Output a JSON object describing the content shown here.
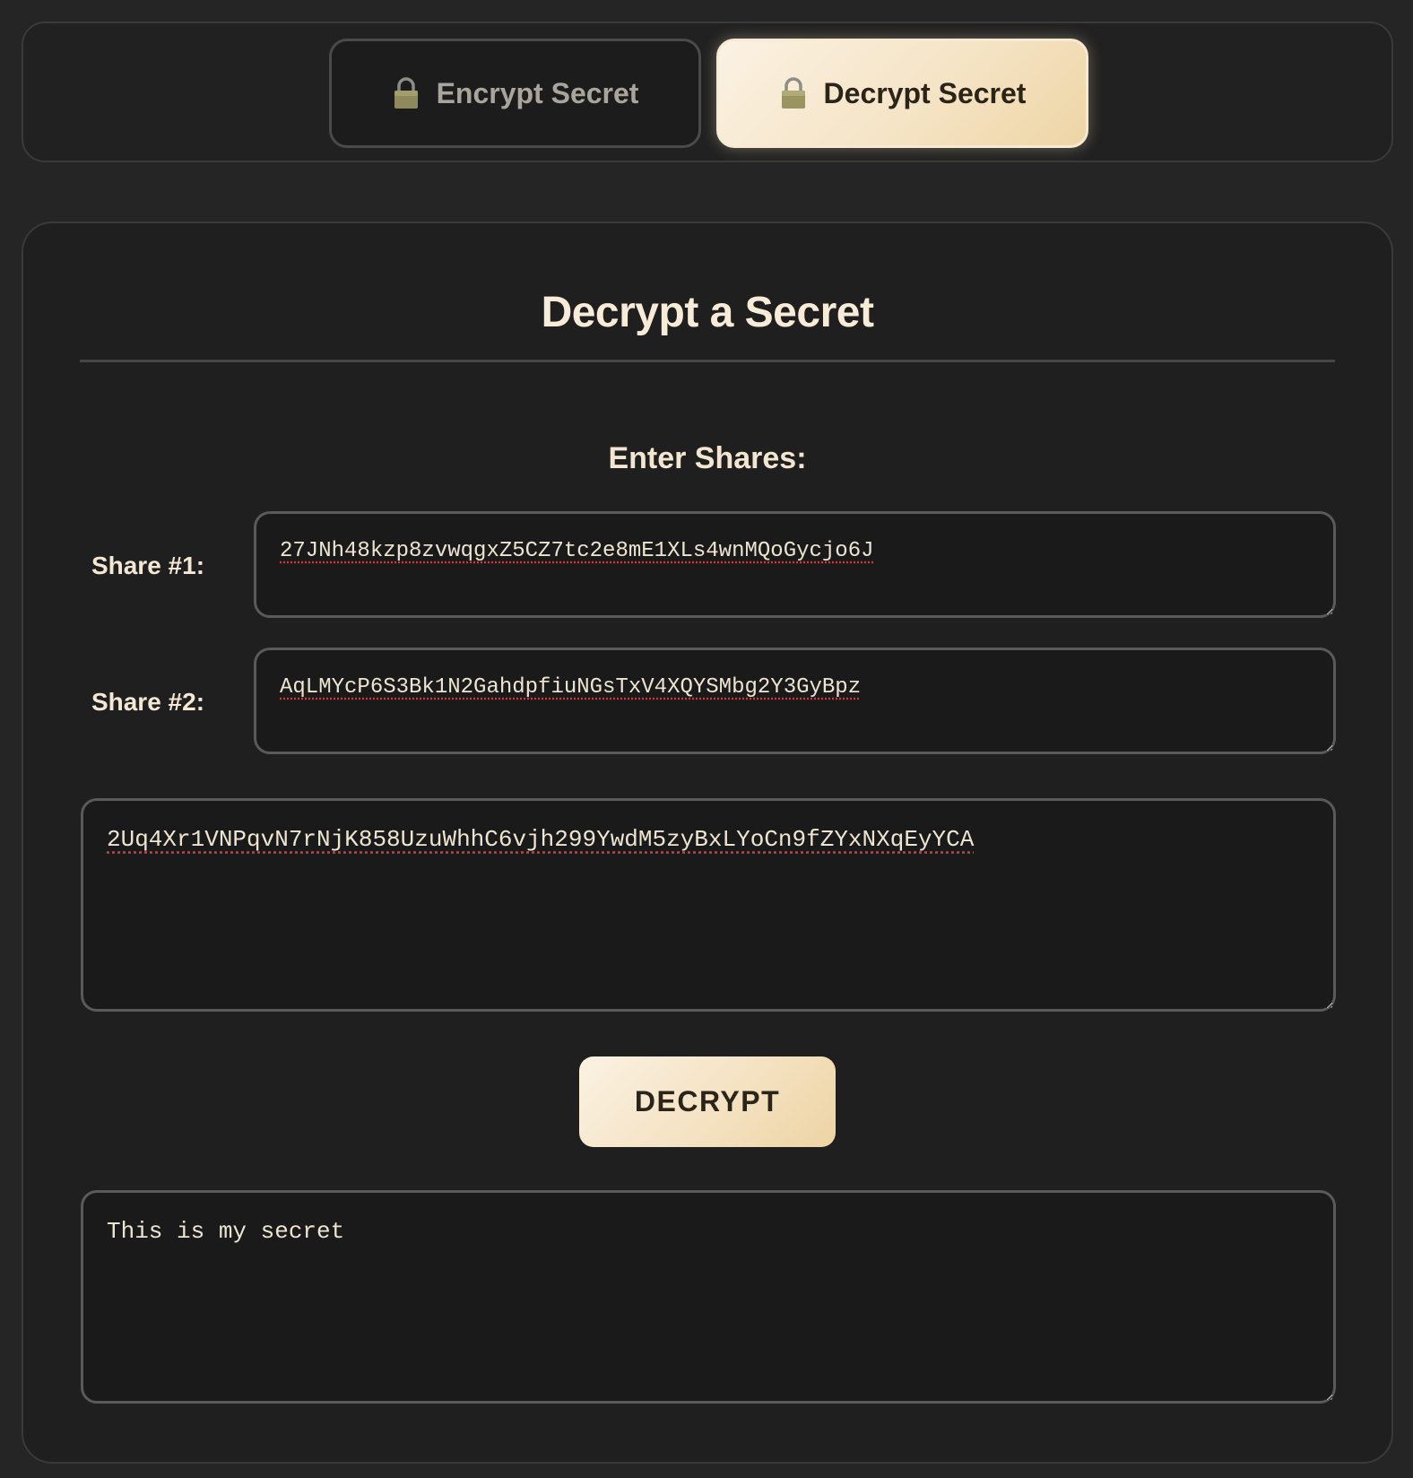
{
  "tabs": {
    "encrypt": {
      "label": "Encrypt Secret",
      "icon": "lock-icon"
    },
    "decrypt": {
      "label": "Decrypt Secret",
      "icon": "lock-icon",
      "active": true
    }
  },
  "card": {
    "title": "Decrypt a Secret",
    "shares_heading": "Enter Shares:",
    "shares": [
      {
        "label": "Share #1:",
        "value": "27JNh48kzp8zvwqgxZ5CZ7tc2e8mE1XLs4wnMQoGycjo6J"
      },
      {
        "label": "Share #2:",
        "value": "AqLMYcP6S3Bk1N2GahdpfiuNGsTxV4XQYSMbg2Y3GyBpz"
      }
    ],
    "ciphertext": "2Uq4Xr1VNPqvN7rNjK858UzuWhhC6vjh299YwdM5zyBxLYoCn9fZYxNXqEyYCA",
    "decrypt_button": "DECRYPT",
    "result": "This is my secret"
  },
  "colors": {
    "background": "#252525",
    "panel": "#1f1f1f",
    "accent_light": "#fbf2e3",
    "accent_gold": "#edd4a4",
    "text": "#f3e6d0",
    "border": "#5a5a5a"
  }
}
